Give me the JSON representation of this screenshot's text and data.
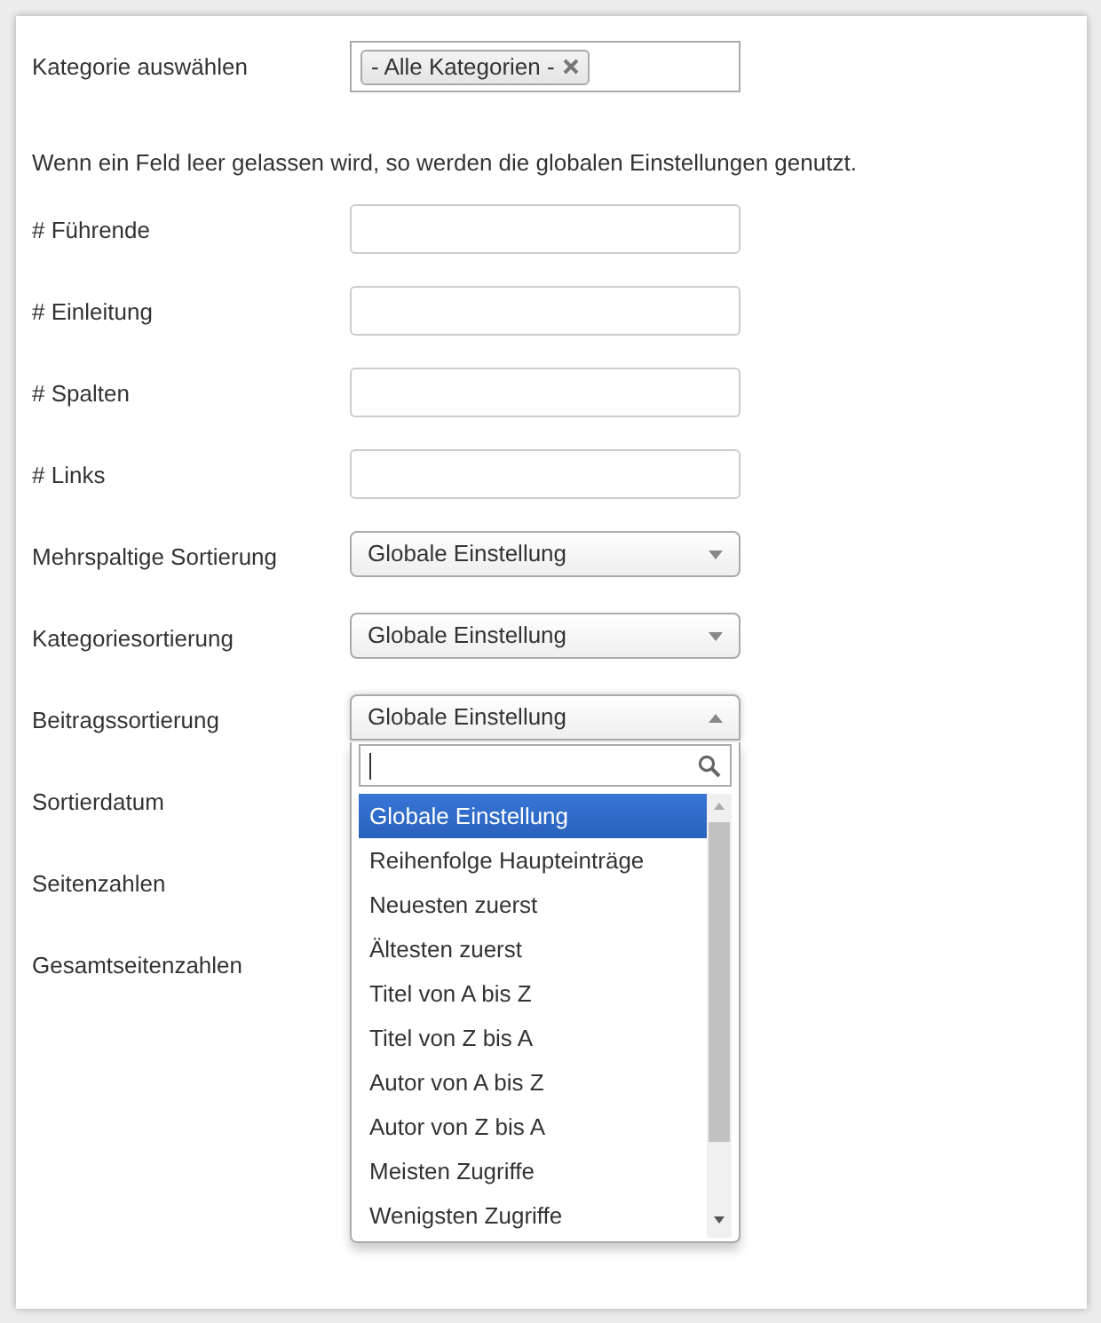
{
  "rows": [
    {
      "kind": "tags",
      "label": "Kategorie auswählen",
      "tags": [
        "- Alle Kategorien -"
      ]
    },
    {
      "kind": "note",
      "label": "Wenn ein Feld leer gelassen wird, so werden die globalen Einstellungen genutzt."
    },
    {
      "kind": "text",
      "label": "# Führende"
    },
    {
      "kind": "text",
      "label": "# Einleitung"
    },
    {
      "kind": "text",
      "label": "# Spalten"
    },
    {
      "kind": "text",
      "label": "# Links"
    },
    {
      "kind": "select",
      "label": "Mehrspaltige Sortierung",
      "value": "Globale Einstellung",
      "expanded": false
    },
    {
      "kind": "select",
      "label": "Kategoriesortierung",
      "value": "Globale Einstellung",
      "expanded": false
    },
    {
      "kind": "select",
      "label": "Beitragssortierung",
      "value": "Globale Einstellung",
      "expanded": true,
      "options": [
        {
          "label": "Globale Einstellung",
          "selected": true
        },
        {
          "label": "Reihenfolge Haupteinträge",
          "selected": false
        },
        {
          "label": "Neuesten zuerst",
          "selected": false
        },
        {
          "label": "Ältesten zuerst",
          "selected": false
        },
        {
          "label": "Titel von A bis Z",
          "selected": false
        },
        {
          "label": "Titel von Z bis A",
          "selected": false
        },
        {
          "label": "Autor von A bis Z",
          "selected": false
        },
        {
          "label": "Autor von Z bis A",
          "selected": false
        },
        {
          "label": "Meisten Zugriffe",
          "selected": false
        },
        {
          "label": "Wenigsten Zugriffe",
          "selected": false
        }
      ]
    },
    {
      "kind": "covered",
      "label": "Sortierdatum"
    },
    {
      "kind": "covered",
      "label": "Seitenzahlen"
    },
    {
      "kind": "covered",
      "label": "Gesamtseitenzahlen"
    }
  ]
}
